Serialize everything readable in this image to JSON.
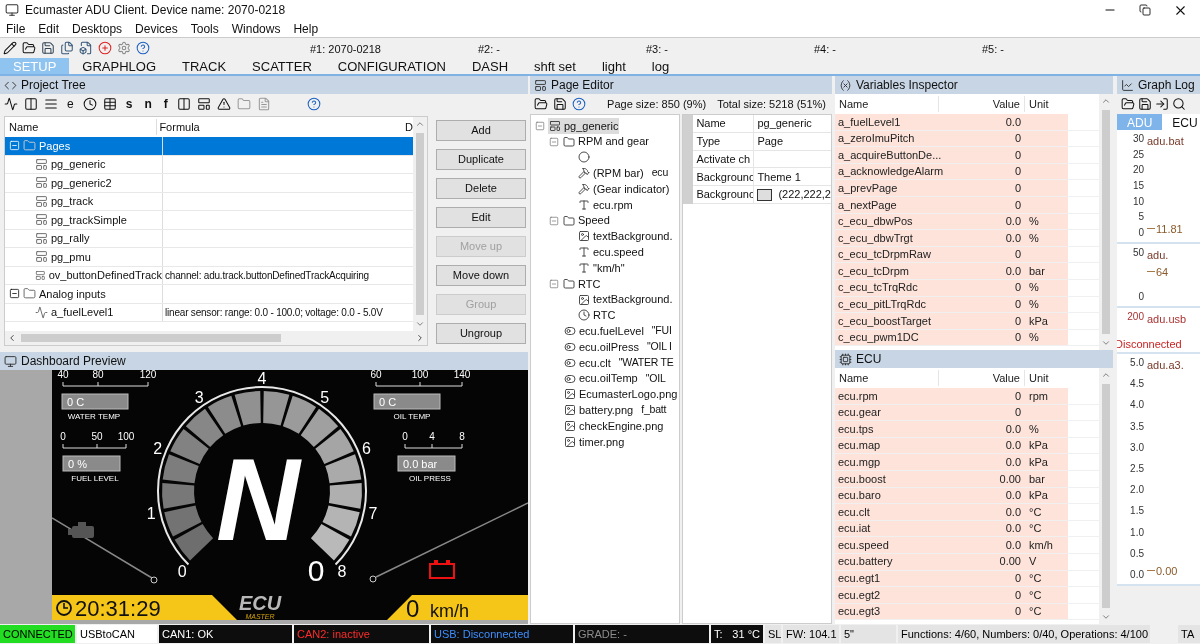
{
  "window": {
    "title": "Ecumaster ADU Client. Device name: 2070-0218"
  },
  "menu": [
    "File",
    "Edit",
    "Desktops",
    "Devices",
    "Tools",
    "Windows",
    "Help"
  ],
  "devices": [
    "#1: 2070-0218",
    "#2: -",
    "#3: -",
    "#4: -",
    "#5: -"
  ],
  "tabs": [
    {
      "label": "SETUP",
      "selected": true
    },
    {
      "label": "GRAPHLOG",
      "selected": false
    },
    {
      "label": "TRACK",
      "selected": false
    },
    {
      "label": "SCATTER",
      "selected": false
    },
    {
      "label": "CONFIGURATION",
      "selected": false
    },
    {
      "label": "DASH",
      "selected": false
    },
    {
      "label": "shft set",
      "selected": false
    },
    {
      "label": "light",
      "selected": false
    },
    {
      "label": "log",
      "selected": false
    }
  ],
  "project_tree": {
    "title": "Project Tree",
    "toolbar_letters": [
      "e",
      "s",
      "n",
      "f"
    ],
    "columns": [
      "Name",
      "Formula",
      "D"
    ],
    "rows": [
      {
        "kind": "folder",
        "name": "Pages",
        "expanded": true,
        "selected": true,
        "children": [
          {
            "kind": "page",
            "name": "pg_generic",
            "selected": false
          },
          {
            "kind": "page",
            "name": "pg_generic2",
            "selected": false
          },
          {
            "kind": "page",
            "name": "pg_track",
            "selected": false
          },
          {
            "kind": "page",
            "name": "pg_trackSimple",
            "selected": false
          },
          {
            "kind": "page",
            "name": "pg_rally",
            "selected": false
          },
          {
            "kind": "page",
            "name": "pg_pmu",
            "selected": false
          },
          {
            "kind": "page",
            "name": "ov_buttonDefinedTrack",
            "formula": "channel: adu.track.buttonDefinedTrackAcquiring",
            "selected": false
          }
        ]
      },
      {
        "kind": "folder",
        "name": "Analog inputs",
        "expanded": true,
        "selected": false,
        "children": [
          {
            "kind": "analog",
            "name": "a_fuelLevel1",
            "formula": "linear sensor: range: 0.0 - 100.0;  voltage: 0.0 - 5.0V",
            "selected": false
          }
        ]
      }
    ],
    "buttons": [
      {
        "label": "Add",
        "disabled": false
      },
      {
        "label": "Duplicate",
        "disabled": false
      },
      {
        "label": "Delete",
        "disabled": false
      },
      {
        "label": "Edit",
        "disabled": false
      },
      {
        "label": "Move up",
        "disabled": true
      },
      {
        "label": "Move down",
        "disabled": false
      },
      {
        "label": "Group",
        "disabled": true
      },
      {
        "label": "Ungroup",
        "disabled": false
      }
    ]
  },
  "dashboard": {
    "title": "Dashboard Preview",
    "gauges": [
      {
        "scale": [
          "40",
          "80",
          "120"
        ],
        "value": "0 C",
        "label": "WATER TEMP"
      },
      {
        "scale": [
          "60",
          "100",
          "140"
        ],
        "value": "0 C",
        "label": "OIL TEMP"
      },
      {
        "scale": [
          "0",
          "50",
          "100"
        ],
        "value": "0 %",
        "label": "FUEL LEVEL"
      },
      {
        "scale": [
          "0",
          "4",
          "8"
        ],
        "value": "0.0 bar",
        "label": "OIL PRESS"
      }
    ],
    "rpm_scale": [
      "0",
      "1",
      "2",
      "3",
      "4",
      "5",
      "6",
      "7",
      "8"
    ],
    "gear": "N",
    "rpm": "0",
    "clock": "20:31:29",
    "speed": "0",
    "speed_unit": "km/h",
    "logo": [
      "ECU",
      "MASTER"
    ]
  },
  "page_editor": {
    "title": "Page Editor",
    "page_size": "Page size: 850 (9%)",
    "total_size": "Total size: 5218 (51%)",
    "tree": [
      {
        "kind": "page",
        "name": "pg_generic",
        "selected": true,
        "children": [
          {
            "kind": "folder",
            "name": "RPM and gear",
            "selected": false,
            "children": [
              {
                "kind": "circle",
                "selected": false
              },
              {
                "kind": "gauge",
                "name": "(RPM bar)",
                "detail": "ecu",
                "selected": false
              },
              {
                "kind": "gauge",
                "name": "(Gear indicator)",
                "selected": false
              },
              {
                "kind": "text",
                "name": "ecu.rpm",
                "selected": false
              }
            ]
          },
          {
            "kind": "folder",
            "name": "Speed",
            "selected": false,
            "children": [
              {
                "kind": "image",
                "name": "textBackground.",
                "selected": false
              },
              {
                "kind": "text",
                "name": "ecu.speed",
                "selected": false
              },
              {
                "kind": "text",
                "name": "\"km/h\"",
                "selected": false
              }
            ]
          },
          {
            "kind": "folder",
            "name": "RTC",
            "selected": false,
            "children": [
              {
                "kind": "image",
                "name": "textBackground.",
                "selected": false
              },
              {
                "kind": "clock",
                "name": "RTC",
                "selected": false
              }
            ]
          },
          {
            "kind": "toggle",
            "name": "ecu.fuelLevel",
            "detail": "\"FUI",
            "selected": false
          },
          {
            "kind": "toggle",
            "name": "ecu.oilPress",
            "detail": "\"OIL I",
            "selected": false
          },
          {
            "kind": "toggle",
            "name": "ecu.clt",
            "detail": "\"WATER TE",
            "selected": false
          },
          {
            "kind": "toggle",
            "name": "ecu.oilTemp",
            "detail": "\"OIL",
            "selected": false
          },
          {
            "kind": "image",
            "name": "EcumasterLogo.png",
            "selected": false
          },
          {
            "kind": "image",
            "name": "battery.png",
            "detail": "f_batt",
            "selected": false
          },
          {
            "kind": "image",
            "name": "checkEngine.png",
            "selected": false
          },
          {
            "kind": "image",
            "name": "timer.png",
            "selected": false
          }
        ]
      }
    ],
    "properties": [
      {
        "kind": "text",
        "name": "Name",
        "value": "pg_generic"
      },
      {
        "kind": "text",
        "name": "Type",
        "value": "Page"
      },
      {
        "kind": "text",
        "name": "Activate ch"
      },
      {
        "kind": "text",
        "name": "Backgrounc",
        "value": "Theme 1"
      },
      {
        "kind": "color",
        "name": "Backgrounc",
        "value": "(222,222,2"
      }
    ]
  },
  "variables_inspector": {
    "title": "Variables Inspector",
    "columns": [
      "Name",
      "Value",
      "Unit"
    ],
    "rows": [
      {
        "name": "a_fuelLevel1",
        "value": "0.0"
      },
      {
        "name": "a_zeroImuPitch",
        "value": "0"
      },
      {
        "name": "a_acquireButtonDe...",
        "value": "0"
      },
      {
        "name": "a_acknowledgeAlarm",
        "value": "0"
      },
      {
        "name": "a_prevPage",
        "value": "0"
      },
      {
        "name": "a_nextPage",
        "value": "0"
      },
      {
        "name": "c_ecu_dbwPos",
        "value": "0.0",
        "unit": "%"
      },
      {
        "name": "c_ecu_dbwTrgt",
        "value": "0.0",
        "unit": "%"
      },
      {
        "name": "c_ecu_tcDrpmRaw",
        "value": "0"
      },
      {
        "name": "c_ecu_tcDrpm",
        "value": "0.0",
        "unit": "bar"
      },
      {
        "name": "c_ecu_tcTrqRdc",
        "value": "0",
        "unit": "%"
      },
      {
        "name": "c_ecu_pitLTrqRdc",
        "value": "0",
        "unit": "%"
      },
      {
        "name": "c_ecu_boostTarget",
        "value": "0",
        "unit": "kPa"
      },
      {
        "name": "c_ecu_pwm1DC",
        "value": "0",
        "unit": "%"
      }
    ]
  },
  "ecu": {
    "title": "ECU",
    "columns": [
      "Name",
      "Value",
      "Unit"
    ],
    "rows": [
      {
        "name": "ecu.rpm",
        "value": "0",
        "unit": "rpm"
      },
      {
        "name": "ecu.gear",
        "value": "0"
      },
      {
        "name": "ecu.tps",
        "value": "0.0",
        "unit": "%"
      },
      {
        "name": "ecu.map",
        "value": "0.0",
        "unit": "kPa"
      },
      {
        "name": "ecu.mgp",
        "value": "0.0",
        "unit": "kPa"
      },
      {
        "name": "ecu.boost",
        "value": "0.00",
        "unit": "bar"
      },
      {
        "name": "ecu.baro",
        "value": "0.0",
        "unit": "kPa"
      },
      {
        "name": "ecu.clt",
        "value": "0.0",
        "unit": "°C"
      },
      {
        "name": "ecu.iat",
        "value": "0.0",
        "unit": "°C"
      },
      {
        "name": "ecu.speed",
        "value": "0.0",
        "unit": "km/h"
      },
      {
        "name": "ecu.battery",
        "value": "0.00",
        "unit": "V"
      },
      {
        "name": "ecu.egt1",
        "value": "0",
        "unit": "°C"
      },
      {
        "name": "ecu.egt2",
        "value": "0",
        "unit": "°C"
      },
      {
        "name": "ecu.egt3",
        "value": "0",
        "unit": "°C"
      }
    ]
  },
  "graph_log": {
    "title": "Graph Log",
    "tabs": [
      {
        "label": "ADU",
        "selected": true
      },
      {
        "label": "ECU",
        "selected": false
      }
    ],
    "plots": [
      {
        "kind": "line",
        "ticks": [
          "30",
          "25",
          "20",
          "15",
          "10",
          "5",
          "0"
        ],
        "label": "adu.bat",
        "reading": "11.81"
      },
      {
        "kind": "line",
        "ticks": [
          "50",
          "0"
        ],
        "label": "adu.",
        "reading": "64"
      },
      {
        "kind": "status",
        "ticks": [
          "200"
        ],
        "label": "adu.usb",
        "reading": "Disconnected"
      },
      {
        "kind": "line",
        "ticks": [
          "5.0",
          "4.5",
          "4.0",
          "3.5",
          "3.0",
          "2.5",
          "2.0",
          "1.5",
          "1.0",
          "0.5",
          "0.0"
        ],
        "label": "adu.a3.",
        "reading": "0.00"
      }
    ]
  },
  "status_bar": [
    {
      "kind": "normal",
      "text": "CONNECTED",
      "color": "#22dd22"
    },
    {
      "kind": "normal",
      "text": "USBtoCAN",
      "color": "#ffffff"
    },
    {
      "kind": "ok",
      "text": "CAN1: OK",
      "color": "#0d0d0d"
    },
    {
      "kind": "error",
      "text": "CAN2: inactive",
      "color": "#0d0d0d"
    },
    {
      "kind": "info",
      "text": "USB: Disconnected",
      "color": "#0d0d0d"
    },
    {
      "kind": "muted",
      "text": "GRADE: -",
      "color": "#0d0d0d"
    },
    {
      "kind": "ok",
      "text": "T:",
      "value": "31 °C",
      "color": "#0d0d0d"
    },
    {
      "kind": "normal",
      "text": "SL",
      "color": "#e4e4e4"
    },
    {
      "kind": "normal",
      "text": "FW: 104.1",
      "color": "#e4e4e4"
    },
    {
      "kind": "normal",
      "text": "5\"",
      "color": "#e4e4e4"
    },
    {
      "kind": "normal",
      "text": "Functions: 4/60, Numbers: 0/40, Operations: 4/100",
      "color": "#e4e4e4"
    },
    {
      "kind": "normal",
      "text": "TA",
      "color": "#e4e4e4"
    }
  ]
}
